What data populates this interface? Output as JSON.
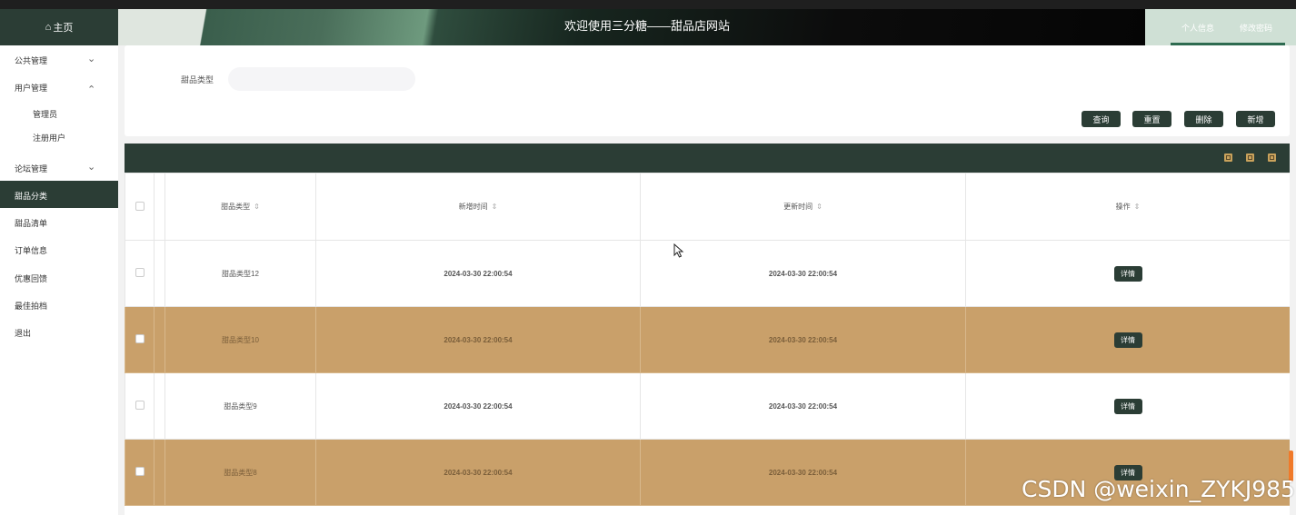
{
  "header": {
    "home_label": "主页",
    "site_title": "欢迎使用三分糖——甜品店网站",
    "user_links": [
      "个人信息",
      "修改密码"
    ]
  },
  "sidebar": {
    "items": [
      {
        "label": "公共管理",
        "expanded": false
      },
      {
        "label": "用户管理",
        "expanded": true
      },
      {
        "label": "管理员"
      },
      {
        "label": "注册用户"
      },
      {
        "label": "论坛管理",
        "expanded": false
      },
      {
        "label": "甜品分类",
        "active": true
      },
      {
        "label": "甜品清单"
      },
      {
        "label": "订单信息"
      },
      {
        "label": "优惠回馈"
      },
      {
        "label": "最佳拍档"
      },
      {
        "label": "退出"
      }
    ]
  },
  "search": {
    "label": "甜品类型",
    "value": "",
    "buttons": {
      "query": "查询",
      "reset": "重置",
      "delete": "删除",
      "add": "新增"
    }
  },
  "table": {
    "columns": [
      "甜品类型",
      "新增时间",
      "更新时间",
      "操作"
    ],
    "rows": [
      {
        "type": "甜品类型12",
        "created": "2024-03-30 22:00:54",
        "updated": "2024-03-30 22:00:54",
        "action": "详情"
      },
      {
        "type": "甜品类型10",
        "created": "2024-03-30 22:00:54",
        "updated": "2024-03-30 22:00:54",
        "action": "详情"
      },
      {
        "type": "甜品类型9",
        "created": "2024-03-30 22:00:54",
        "updated": "2024-03-30 22:00:54",
        "action": "详情"
      },
      {
        "type": "甜品类型8",
        "created": "2024-03-30 22:00:54",
        "updated": "2024-03-30 22:00:54",
        "action": "详情"
      }
    ]
  },
  "watermark": "CSDN @weixin_ZYKJ985",
  "colors": {
    "primary": "#2b3d35",
    "row_highlight": "#c9a06a",
    "toolbar_icon": "#c9a25c"
  }
}
